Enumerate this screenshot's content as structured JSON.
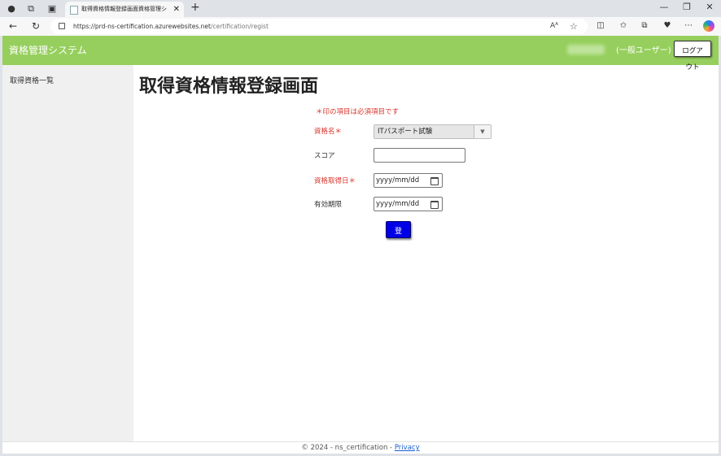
{
  "browser": {
    "tab_title": "取得資格情報登録画面資格管理シ",
    "url_host": "https://prd-ns-certification.azurewebsites.net",
    "url_path": "/certification/regist",
    "reader_label": "Aᴬ"
  },
  "app": {
    "brand": "資格管理システム",
    "user_role": "(一般ユーザー)",
    "logout_label": "ログアウト"
  },
  "sidebar": {
    "items": [
      {
        "label": "取得資格一覧"
      }
    ]
  },
  "form": {
    "page_title": "取得資格情報登録画面",
    "required_note": "＊印の項目は必須項目です",
    "fields": {
      "cert_name": {
        "label": "資格名＊",
        "value": "ITパスポート試験"
      },
      "score": {
        "label": "スコア",
        "value": ""
      },
      "acquired_date": {
        "label": "資格取得日＊",
        "placeholder": "yyyy/mm/dd"
      },
      "expiry_date": {
        "label": "有効期限",
        "placeholder": "yyyy/mm/dd"
      }
    },
    "submit_label": "登録"
  },
  "footer": {
    "text": "© 2024 - ns_certification - ",
    "privacy_label": "Privacy"
  },
  "colors": {
    "header": "#96cf5d",
    "required": "#d9342b",
    "submit": "#0000e6"
  }
}
